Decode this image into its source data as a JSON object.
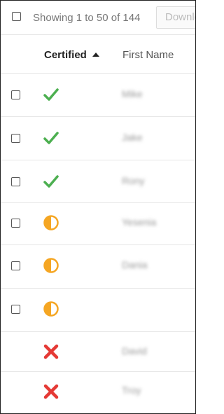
{
  "toolbar": {
    "showing_text": "Showing 1 to 50 of 144",
    "download_label": "Download"
  },
  "columns": {
    "certified": "Certified",
    "first_name": "First Name",
    "sort_direction": "ascending"
  },
  "colors": {
    "check": "#4caf50",
    "partial": "#f5a623",
    "cross": "#e53935"
  },
  "rows": [
    {
      "status": "certified",
      "status_icon": "check-icon",
      "first_name": "Mike"
    },
    {
      "status": "certified",
      "status_icon": "check-icon",
      "first_name": "Jake"
    },
    {
      "status": "certified",
      "status_icon": "check-icon",
      "first_name": "Rony"
    },
    {
      "status": "partial",
      "status_icon": "half-circle-icon",
      "first_name": "Yesenia"
    },
    {
      "status": "partial",
      "status_icon": "half-circle-icon",
      "first_name": "Dania"
    },
    {
      "status": "partial",
      "status_icon": "half-circle-icon",
      "first_name": ""
    },
    {
      "status": "not-certified",
      "status_icon": "cross-icon",
      "first_name": "David"
    },
    {
      "status": "not-certified",
      "status_icon": "cross-icon",
      "first_name": "Troy"
    }
  ]
}
